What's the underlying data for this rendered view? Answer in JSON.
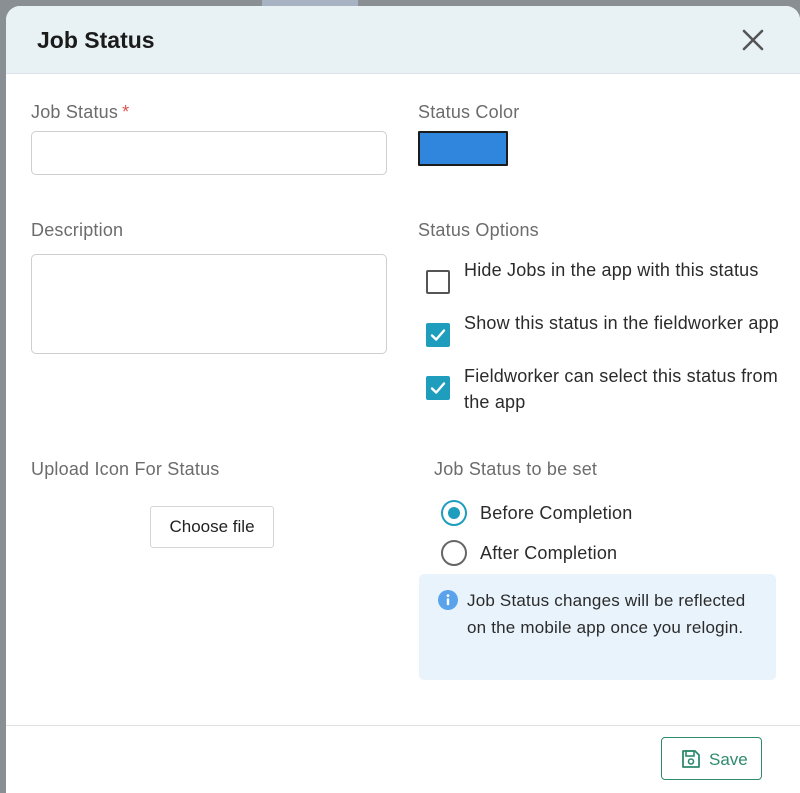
{
  "modal": {
    "title": "Job Status",
    "close_icon": "close-icon"
  },
  "form": {
    "job_status": {
      "label": "Job Status",
      "required_marker": "*",
      "value": "",
      "placeholder": ""
    },
    "status_color": {
      "label": "Status Color",
      "value": "#2f86dc"
    },
    "description": {
      "label": "Description",
      "value": ""
    },
    "status_options": {
      "label": "Status Options",
      "items": [
        {
          "label": "Hide Jobs in the app with this status",
          "checked": false
        },
        {
          "label": "Show this status in the fieldworker app",
          "checked": true
        },
        {
          "label": "Fieldworker can select this status from the app",
          "checked": true
        }
      ]
    },
    "upload_icon": {
      "label": "Upload Icon For Status",
      "button_label": "Choose file"
    },
    "job_status_to_be_set": {
      "label": "Job Status to be set",
      "options": [
        {
          "label": "Before Completion",
          "selected": true
        },
        {
          "label": "After Completion",
          "selected": false
        }
      ]
    },
    "info": {
      "icon": "info-icon",
      "text": "Job Status changes will be reflected on the mobile app once you relogin."
    }
  },
  "footer": {
    "save_label": "Save",
    "save_icon": "floppy-disk-icon"
  },
  "colors": {
    "accent": "#1f9dbd",
    "save": "#2e8a6e",
    "required": "#d9534f",
    "header_bg": "#e8f2f4",
    "info_bg": "#e9f3fc"
  }
}
